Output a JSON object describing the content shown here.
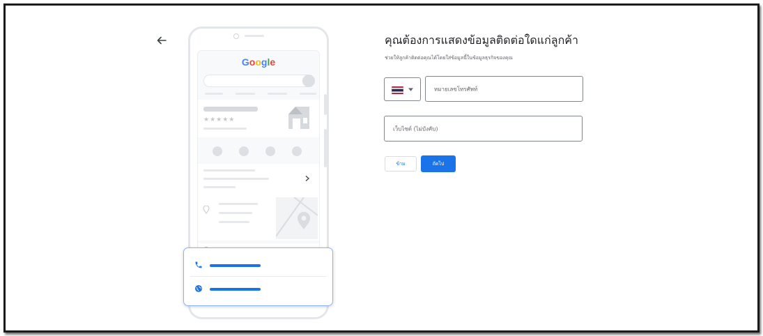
{
  "page": {
    "title": "คุณต้องการแสดงข้อมูลติดต่อใดแก่ลูกค้า",
    "subtitle": "ช่วยให้ลูกค้าติดต่อคุณได้โดยใส่ข้อมูลนี้ในข้อมูลธุรกิจของคุณ"
  },
  "illustration": {
    "logo": "Google",
    "rating_stars": "★★★★★"
  },
  "form": {
    "country_flag": "thailand-flag",
    "phone_placeholder": "หมายเลขโทรศัพท์",
    "website_placeholder": "เว็บไซต์ (ไม่บังคับ)"
  },
  "buttons": {
    "skip_label": "ข้าม",
    "next_label": "ถัดไป"
  },
  "colors": {
    "primary": "#1a73e8",
    "card_border": "#8ab4f8"
  }
}
